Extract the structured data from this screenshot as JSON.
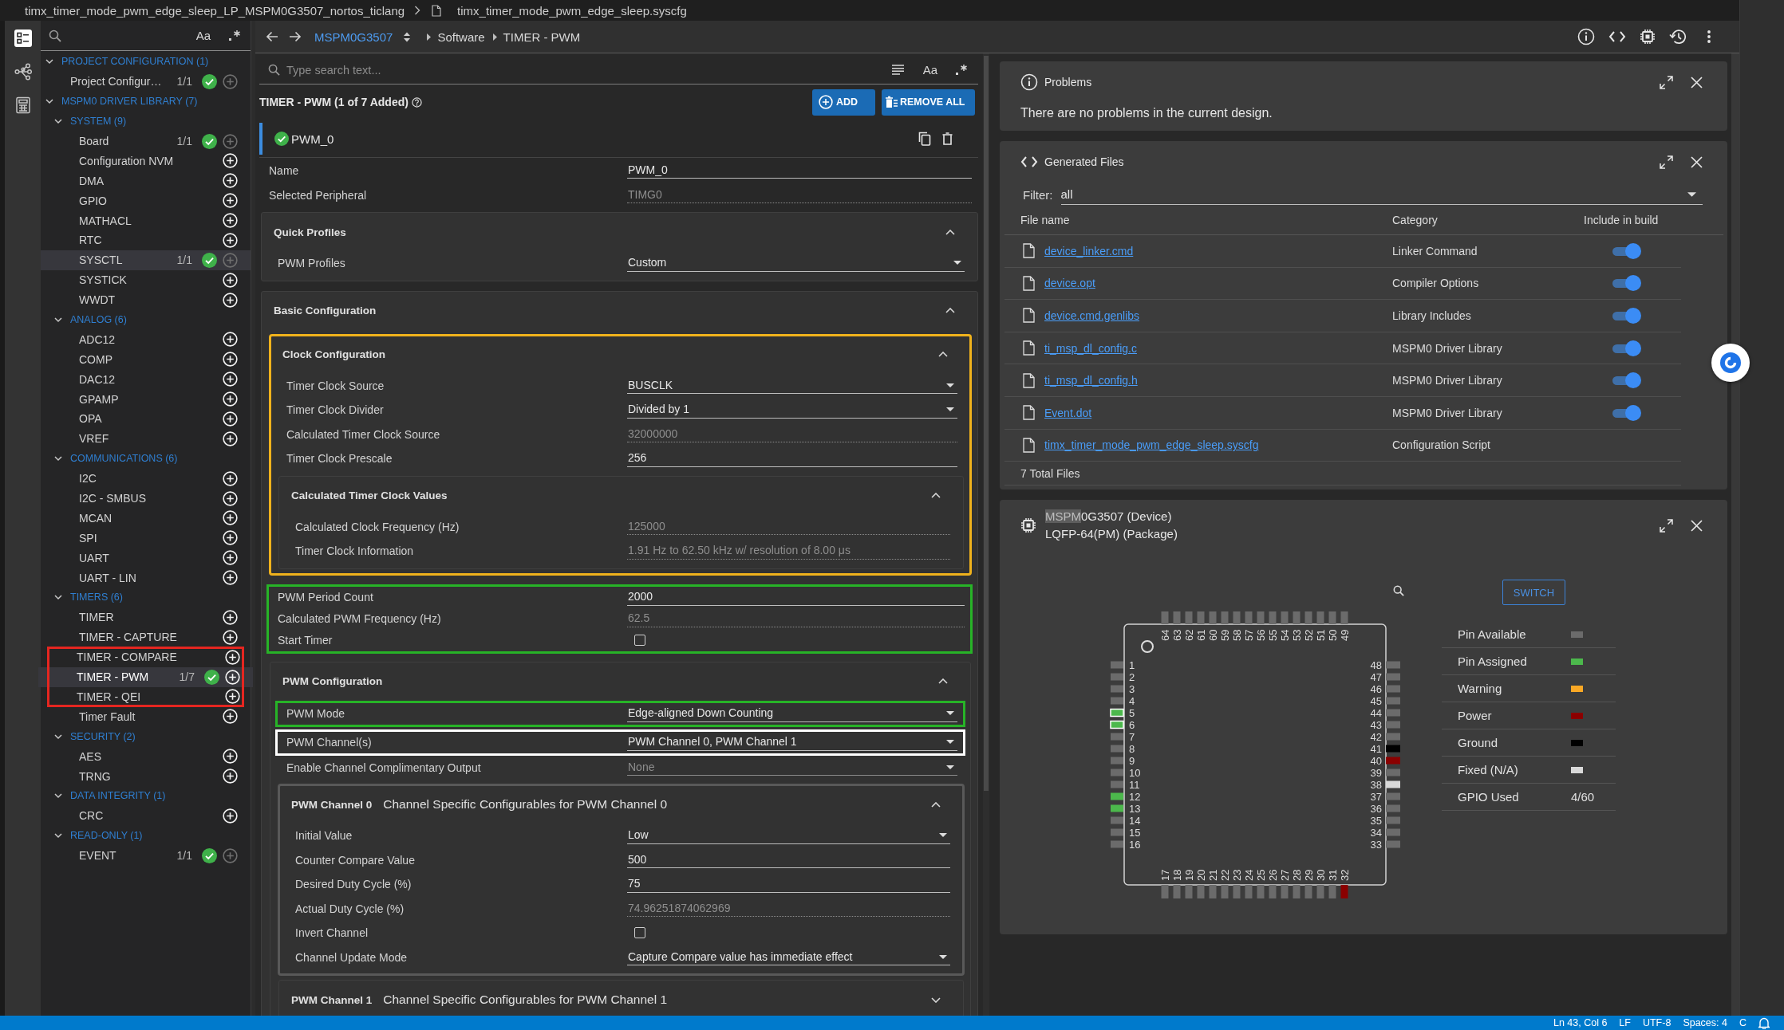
{
  "title_bar": {
    "project": "timx_timer_mode_pwm_edge_sleep_LP_MSPM0G3507_nortos_ticlang",
    "file": "timx_timer_mode_pwm_edge_sleep.syscfg"
  },
  "activity_bar": [
    {
      "kind": "modules",
      "selected": true
    },
    {
      "kind": "network",
      "selected": false
    },
    {
      "kind": "calculator",
      "selected": false
    }
  ],
  "sidebar": {
    "search": {
      "case_label": "Aa"
    },
    "tree": [
      {
        "kind": "group",
        "label": "PROJECT CONFIGURATION (1)",
        "expanded": true,
        "children": [
          {
            "kind": "module",
            "label": "Project Configur…",
            "count": "1/1",
            "added": true,
            "can_add": false,
            "selected": false,
            "hovered": false
          }
        ]
      },
      {
        "kind": "group",
        "label": "MSPM0 DRIVER LIBRARY (7)",
        "expanded": true,
        "children": [
          {
            "kind": "group",
            "label": "SYSTEM (9)",
            "expanded": true,
            "children": [
              {
                "kind": "module",
                "label": "Board",
                "count": "1/1",
                "added": true,
                "can_add": false,
                "selected": false,
                "hovered": false
              },
              {
                "kind": "module",
                "label": "Configuration NVM",
                "added": false,
                "can_add": true,
                "selected": false,
                "hovered": false
              },
              {
                "kind": "module",
                "label": "DMA",
                "added": false,
                "can_add": true,
                "selected": false,
                "hovered": false
              },
              {
                "kind": "module",
                "label": "GPIO",
                "added": false,
                "can_add": true,
                "selected": false,
                "hovered": false
              },
              {
                "kind": "module",
                "label": "MATHACL",
                "added": false,
                "can_add": true,
                "selected": false,
                "hovered": false
              },
              {
                "kind": "module",
                "label": "RTC",
                "added": false,
                "can_add": true,
                "selected": false,
                "hovered": false
              },
              {
                "kind": "module",
                "label": "SYSCTL",
                "count": "1/1",
                "added": true,
                "can_add": false,
                "selected": false,
                "hovered": true
              },
              {
                "kind": "module",
                "label": "SYSTICK",
                "added": false,
                "can_add": true,
                "selected": false,
                "hovered": false
              },
              {
                "kind": "module",
                "label": "WWDT",
                "added": false,
                "can_add": true,
                "selected": false,
                "hovered": false
              }
            ]
          },
          {
            "kind": "group",
            "label": "ANALOG (6)",
            "expanded": true,
            "children": [
              {
                "kind": "module",
                "label": "ADC12",
                "added": false,
                "can_add": true,
                "selected": false,
                "hovered": false
              },
              {
                "kind": "module",
                "label": "COMP",
                "added": false,
                "can_add": true,
                "selected": false,
                "hovered": false
              },
              {
                "kind": "module",
                "label": "DAC12",
                "added": false,
                "can_add": true,
                "selected": false,
                "hovered": false
              },
              {
                "kind": "module",
                "label": "GPAMP",
                "added": false,
                "can_add": true,
                "selected": false,
                "hovered": false
              },
              {
                "kind": "module",
                "label": "OPA",
                "added": false,
                "can_add": true,
                "selected": false,
                "hovered": false
              },
              {
                "kind": "module",
                "label": "VREF",
                "added": false,
                "can_add": true,
                "selected": false,
                "hovered": false
              }
            ]
          },
          {
            "kind": "group",
            "label": "COMMUNICATIONS (6)",
            "expanded": true,
            "children": [
              {
                "kind": "module",
                "label": "I2C",
                "added": false,
                "can_add": true,
                "selected": false,
                "hovered": false
              },
              {
                "kind": "module",
                "label": "I2C - SMBUS",
                "added": false,
                "can_add": true,
                "selected": false,
                "hovered": false
              },
              {
                "kind": "module",
                "label": "MCAN",
                "added": false,
                "can_add": true,
                "selected": false,
                "hovered": false
              },
              {
                "kind": "module",
                "label": "SPI",
                "added": false,
                "can_add": true,
                "selected": false,
                "hovered": false
              },
              {
                "kind": "module",
                "label": "UART",
                "added": false,
                "can_add": true,
                "selected": false,
                "hovered": false
              },
              {
                "kind": "module",
                "label": "UART - LIN",
                "added": false,
                "can_add": true,
                "selected": false,
                "hovered": false
              }
            ]
          },
          {
            "kind": "group",
            "label": "TIMERS (6)",
            "expanded": true,
            "children": [
              {
                "kind": "module",
                "label": "TIMER",
                "added": false,
                "can_add": true,
                "selected": false,
                "hovered": false
              },
              {
                "kind": "module",
                "label": "TIMER - CAPTURE",
                "added": false,
                "can_add": true,
                "selected": false,
                "hovered": false
              },
              {
                "kind": "module",
                "label": "TIMER - COMPARE",
                "added": false,
                "can_add": true,
                "selected": false,
                "hovered": false,
                "color": "#e52620"
              },
              {
                "kind": "module",
                "label": "TIMER - PWM",
                "count": "1/7",
                "added": true,
                "can_add": true,
                "selected": true,
                "hovered": false,
                "color": "#e52620"
              },
              {
                "kind": "module",
                "label": "TIMER - QEI",
                "added": false,
                "can_add": true,
                "selected": false,
                "hovered": false,
                "color": "#e52620"
              },
              {
                "kind": "module",
                "label": "Timer Fault",
                "added": false,
                "can_add": true,
                "selected": false,
                "hovered": false
              }
            ]
          },
          {
            "kind": "group",
            "label": "SECURITY (2)",
            "expanded": true,
            "children": [
              {
                "kind": "module",
                "label": "AES",
                "added": false,
                "can_add": true,
                "selected": false,
                "hovered": false
              },
              {
                "kind": "module",
                "label": "TRNG",
                "added": false,
                "can_add": true,
                "selected": false,
                "hovered": false
              }
            ]
          },
          {
            "kind": "group",
            "label": "DATA INTEGRITY (1)",
            "expanded": true,
            "children": [
              {
                "kind": "module",
                "label": "CRC",
                "added": false,
                "can_add": true,
                "selected": false,
                "hovered": false
              }
            ]
          },
          {
            "kind": "group",
            "label": "READ-ONLY (1)",
            "expanded": true,
            "children": [
              {
                "kind": "module",
                "label": "EVENT",
                "count": "1/1",
                "added": true,
                "can_add": false,
                "selected": false,
                "hovered": false
              }
            ]
          }
        ]
      }
    ]
  },
  "nav": {
    "device": "MSPM0G3507",
    "path": [
      "Software",
      "TIMER - PWM"
    ]
  },
  "search": {
    "placeholder": "Type search text...",
    "case_label": "Aa"
  },
  "module": {
    "title": "TIMER - PWM (1 of 7 Added)",
    "add_label": "ADD",
    "remove_label": "REMOVE ALL",
    "instance": {
      "name": "PWM_0",
      "valid": true,
      "selected": true
    }
  },
  "fields": [
    {
      "kind": "text",
      "label": "Name",
      "value": "PWM_0"
    },
    {
      "kind": "readonly",
      "label": "Selected Peripheral",
      "value": "TIMG0"
    }
  ],
  "sections": [
    {
      "title": "Quick Profiles",
      "expanded": true,
      "items": [
        {
          "kind": "select",
          "label": "PWM Profiles",
          "value": "Custom",
          "disabled": false
        }
      ]
    },
    {
      "title": "Basic Configuration",
      "expanded": true,
      "items": [
        {
          "kind": "section",
          "title": "Clock Configuration",
          "expanded": true,
          "color": "#f0b21c",
          "items": [
            {
              "kind": "select",
              "label": "Timer Clock Source",
              "value": "BUSCLK",
              "disabled": false
            },
            {
              "kind": "select",
              "label": "Timer Clock Divider",
              "value": "Divided by 1",
              "disabled": false
            },
            {
              "kind": "readonly",
              "label": "Calculated Timer Clock Source",
              "value": "32000000"
            },
            {
              "kind": "text",
              "label": "Timer Clock Prescale",
              "value": "256"
            },
            {
              "kind": "section",
              "title": "Calculated Timer Clock Values",
              "expanded": true,
              "items": [
                {
                  "kind": "readonly",
                  "label": "Calculated Clock Frequency (Hz)",
                  "value": "125000"
                },
                {
                  "kind": "readonly",
                  "label": "Timer Clock Information",
                  "value": "1.91 Hz to 62.50 kHz w/ resolution of 8.00 μs"
                }
              ]
            }
          ]
        },
        {
          "kind": "text",
          "label": "PWM Period Count",
          "value": "2000",
          "color": "#27b327"
        },
        {
          "kind": "readonly",
          "label": "Calculated PWM Frequency (Hz)",
          "value": "62.5",
          "color": "#27b327"
        },
        {
          "kind": "checkbox",
          "label": "Start Timer",
          "checked": false,
          "color": "#27b327"
        },
        {
          "kind": "section",
          "title": "PWM Configuration",
          "expanded": true,
          "items": [
            {
              "kind": "select",
              "label": "PWM Mode",
              "value": "Edge-aligned Down Counting",
              "disabled": false,
              "color": "#27b327"
            },
            {
              "kind": "select",
              "label": "PWM Channel(s)",
              "value": "PWM Channel 0, PWM Channel 1",
              "disabled": false,
              "color": "#ffffff"
            },
            {
              "kind": "select",
              "label": "Enable Channel Complimentary Output",
              "value": "None",
              "disabled": true
            },
            {
              "kind": "section",
              "title": "PWM Channel 0",
              "subtitle": "Channel Specific Configurables for PWM Channel 0",
              "expanded": true,
              "color": "#595959",
              "items": [
                {
                  "kind": "select",
                  "label": "Initial Value",
                  "value": "Low",
                  "disabled": false
                },
                {
                  "kind": "text",
                  "label": "Counter Compare Value",
                  "value": "500"
                },
                {
                  "kind": "text",
                  "label": "Desired Duty Cycle (%)",
                  "value": "75"
                },
                {
                  "kind": "readonly",
                  "label": "Actual Duty Cycle (%)",
                  "value": "74.96251874062969"
                },
                {
                  "kind": "checkbox",
                  "label": "Invert Channel",
                  "checked": false
                },
                {
                  "kind": "select",
                  "label": "Channel Update Mode",
                  "value": "Capture Compare value has immediate effect",
                  "disabled": false
                }
              ]
            },
            {
              "kind": "section",
              "title": "PWM Channel 1",
              "subtitle": "Channel Specific Configurables for PWM Channel 1",
              "expanded": false
            }
          ]
        }
      ]
    }
  ],
  "problems": {
    "title": "Problems",
    "message": "There are no problems in the current design."
  },
  "generated_files": {
    "title": "Generated Files",
    "filter_label": "Filter:",
    "filter_value": "all",
    "columns": [
      "File name",
      "Category",
      "Include in build"
    ],
    "files": [
      {
        "name": "device_linker.cmd",
        "category": "Linker Command",
        "include": true
      },
      {
        "name": "device.opt",
        "category": "Compiler Options",
        "include": true
      },
      {
        "name": "device.cmd.genlibs",
        "category": "Library Includes",
        "include": true
      },
      {
        "name": "ti_msp_dl_config.c",
        "category": "MSPM0 Driver Library",
        "include": true
      },
      {
        "name": "ti_msp_dl_config.h",
        "category": "MSPM0 Driver Library",
        "include": true
      },
      {
        "name": "Event.dot",
        "category": "MSPM0 Driver Library",
        "include": true
      },
      {
        "name": "timx_timer_mode_pwm_edge_sleep.syscfg",
        "category": "Configuration Script"
      }
    ],
    "total": "7 Total Files"
  },
  "device": {
    "name_match": "MSPM",
    "name_rest": "0G3507 (Device)",
    "package": "LQFP-64(PM) (Package)",
    "switch_label": "SWITCH",
    "pins": {
      "top": [
        {
          "n": "64",
          "kind": "available",
          "selected": false
        },
        {
          "n": "63",
          "kind": "available",
          "selected": false
        },
        {
          "n": "62",
          "kind": "available",
          "selected": false
        },
        {
          "n": "61",
          "kind": "available",
          "selected": false
        },
        {
          "n": "60",
          "kind": "available",
          "selected": false
        },
        {
          "n": "59",
          "kind": "available",
          "selected": false
        },
        {
          "n": "58",
          "kind": "available",
          "selected": false
        },
        {
          "n": "57",
          "kind": "available",
          "selected": false
        },
        {
          "n": "56",
          "kind": "available",
          "selected": false
        },
        {
          "n": "55",
          "kind": "available",
          "selected": false
        },
        {
          "n": "54",
          "kind": "available",
          "selected": false
        },
        {
          "n": "53",
          "kind": "available",
          "selected": false
        },
        {
          "n": "52",
          "kind": "available",
          "selected": false
        },
        {
          "n": "51",
          "kind": "available",
          "selected": false
        },
        {
          "n": "50",
          "kind": "available",
          "selected": false
        },
        {
          "n": "49",
          "kind": "available",
          "selected": false
        }
      ],
      "left": [
        {
          "n": "1",
          "kind": "available",
          "selected": false
        },
        {
          "n": "2",
          "kind": "available",
          "selected": false
        },
        {
          "n": "3",
          "kind": "available",
          "selected": false
        },
        {
          "n": "4",
          "kind": "available",
          "selected": false
        },
        {
          "n": "5",
          "kind": "assigned",
          "selected": true
        },
        {
          "n": "6",
          "kind": "assigned",
          "selected": true
        },
        {
          "n": "7",
          "kind": "available",
          "selected": false
        },
        {
          "n": "8",
          "kind": "available",
          "selected": false
        },
        {
          "n": "9",
          "kind": "available",
          "selected": false
        },
        {
          "n": "10",
          "kind": "available",
          "selected": false
        },
        {
          "n": "11",
          "kind": "available",
          "selected": false
        },
        {
          "n": "12",
          "kind": "assigned",
          "selected": false
        },
        {
          "n": "13",
          "kind": "assigned",
          "selected": false
        },
        {
          "n": "14",
          "kind": "available",
          "selected": false
        },
        {
          "n": "15",
          "kind": "available",
          "selected": false
        },
        {
          "n": "16",
          "kind": "available",
          "selected": false
        }
      ],
      "right": [
        {
          "n": "48",
          "kind": "available",
          "selected": false
        },
        {
          "n": "47",
          "kind": "available",
          "selected": false
        },
        {
          "n": "46",
          "kind": "available",
          "selected": false
        },
        {
          "n": "45",
          "kind": "available",
          "selected": false
        },
        {
          "n": "44",
          "kind": "available",
          "selected": false
        },
        {
          "n": "43",
          "kind": "available",
          "selected": false
        },
        {
          "n": "42",
          "kind": "available",
          "selected": false
        },
        {
          "n": "41",
          "kind": "ground",
          "selected": false
        },
        {
          "n": "40",
          "kind": "power",
          "selected": false
        },
        {
          "n": "39",
          "kind": "available",
          "selected": false
        },
        {
          "n": "38",
          "kind": "fixed",
          "selected": false
        },
        {
          "n": "37",
          "kind": "available",
          "selected": false
        },
        {
          "n": "36",
          "kind": "available",
          "selected": false
        },
        {
          "n": "35",
          "kind": "available",
          "selected": false
        },
        {
          "n": "34",
          "kind": "available",
          "selected": false
        },
        {
          "n": "33",
          "kind": "available",
          "selected": false
        }
      ],
      "bottom": [
        {
          "n": "17",
          "kind": "available",
          "selected": false
        },
        {
          "n": "18",
          "kind": "available",
          "selected": false
        },
        {
          "n": "19",
          "kind": "available",
          "selected": false
        },
        {
          "n": "20",
          "kind": "available",
          "selected": false
        },
        {
          "n": "21",
          "kind": "available",
          "selected": false
        },
        {
          "n": "22",
          "kind": "available",
          "selected": false
        },
        {
          "n": "23",
          "kind": "available",
          "selected": false
        },
        {
          "n": "24",
          "kind": "available",
          "selected": false
        },
        {
          "n": "25",
          "kind": "available",
          "selected": false
        },
        {
          "n": "26",
          "kind": "available",
          "selected": false
        },
        {
          "n": "27",
          "kind": "available",
          "selected": false
        },
        {
          "n": "28",
          "kind": "available",
          "selected": false
        },
        {
          "n": "29",
          "kind": "available",
          "selected": false
        },
        {
          "n": "30",
          "kind": "available",
          "selected": false
        },
        {
          "n": "31",
          "kind": "available",
          "selected": false
        },
        {
          "n": "32",
          "kind": "power",
          "selected": false
        }
      ]
    },
    "legend": [
      {
        "label": "Pin Available",
        "kind": "available",
        "color": "#6b6b6b"
      },
      {
        "label": "Pin Assigned",
        "kind": "assigned",
        "color": "#4cb84c"
      },
      {
        "label": "Warning",
        "kind": "warning",
        "color": "#f9a825"
      },
      {
        "label": "Power",
        "kind": "power",
        "color": "#8b0000"
      },
      {
        "label": "Ground",
        "kind": "ground",
        "color": "#000000"
      },
      {
        "label": "Fixed (N/A)",
        "kind": "fixed",
        "color": "#d9d9d9"
      }
    ],
    "gpio_used": {
      "label": "GPIO Used",
      "value": "4/60"
    }
  },
  "status_bar": [
    "Ln 43, Col 6",
    "LF",
    "UTF-8",
    "Spaces: 4",
    "C"
  ]
}
